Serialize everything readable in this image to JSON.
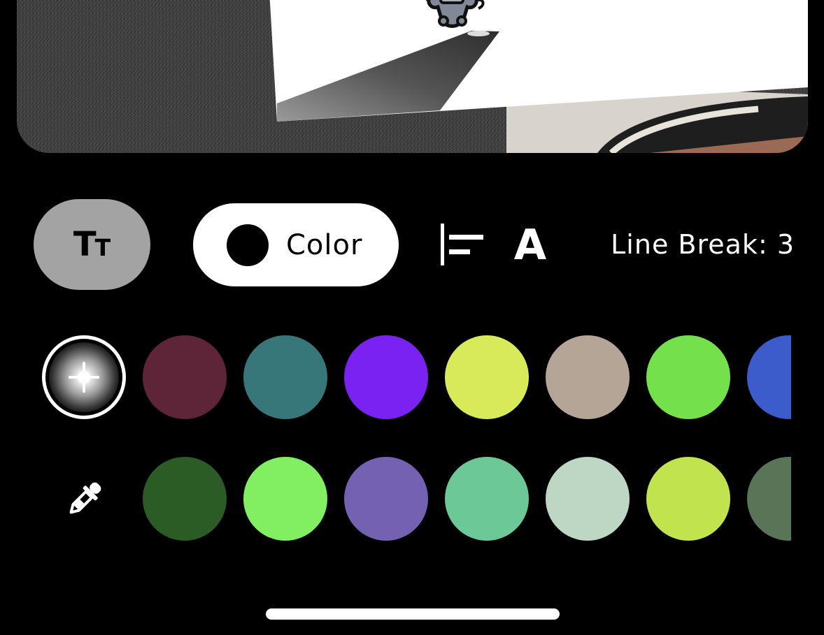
{
  "toolbar": {
    "font_style_big": "T",
    "font_style_small": "T",
    "color_label": "Color",
    "selected_color": "#000000",
    "text_style_label": "A",
    "line_break_label": "Line Break: 3"
  },
  "icons": {
    "font_style": "text-size-icon",
    "align": "align-left-icon",
    "eyedropper": "eyedropper-icon",
    "color_wheel": "color-picker-icon"
  },
  "palette": {
    "row1": [
      "#5e2538",
      "#37777a",
      "#7a22f2",
      "#d8ea5a",
      "#b5a597",
      "#74e04c",
      "#3d5ccc"
    ],
    "row2": [
      "#2b5c25",
      "#82ee62",
      "#7561b2",
      "#6cc896",
      "#bed6c4",
      "#c0e34e",
      "#5a7458"
    ]
  }
}
